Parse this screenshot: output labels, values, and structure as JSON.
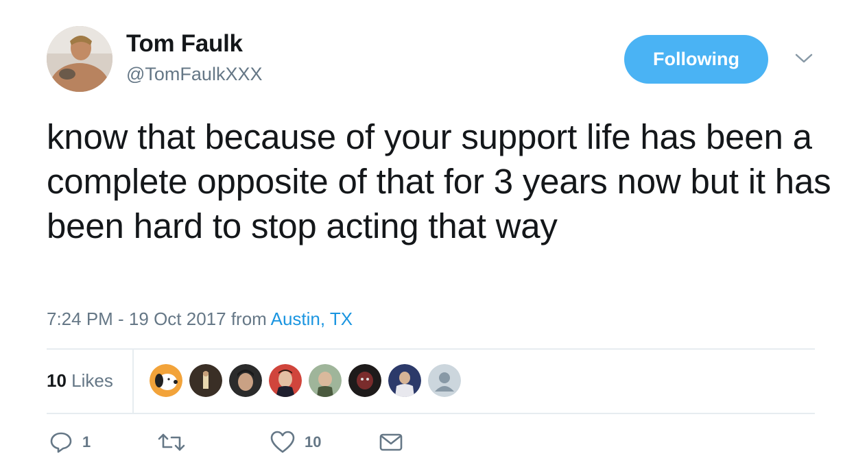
{
  "author": {
    "name": "Tom Faulk",
    "handle": "@TomFaulkXXX",
    "avatar_icon": "profile-photo"
  },
  "follow_button": {
    "label": "Following",
    "color": "#4ab3f4"
  },
  "menu": {
    "icon": "chevron-down-icon"
  },
  "tweet": {
    "text": "know that because of your support life has been a complete opposite of that for 3 years now but it has been hard to stop acting that way"
  },
  "meta": {
    "time_date": "7:24 PM - 19 Oct 2017",
    "from": "from",
    "location": "Austin, TX"
  },
  "likes": {
    "count": "10",
    "label": "Likes"
  },
  "likers": [
    {
      "icon": "snoopy-avatar"
    },
    {
      "icon": "user-avatar"
    },
    {
      "icon": "user-avatar"
    },
    {
      "icon": "user-avatar"
    },
    {
      "icon": "user-avatar"
    },
    {
      "icon": "user-avatar"
    },
    {
      "icon": "user-avatar"
    },
    {
      "icon": "default-avatar"
    }
  ],
  "actions": {
    "reply_count": "1",
    "retweet_count": "",
    "like_count": "10"
  },
  "colors": {
    "link": "#1b95e0",
    "secondary": "#657786",
    "divider": "#e6ecf0"
  }
}
